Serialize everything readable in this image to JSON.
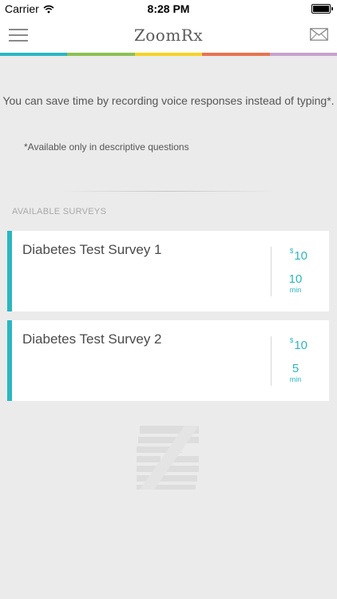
{
  "status_bar": {
    "carrier": "Carrier",
    "time": "8:28 PM"
  },
  "nav": {
    "title": "ZoomRx",
    "menu_icon": "hamburger-menu-icon",
    "mail_icon": "envelope-icon"
  },
  "brand_colors": [
    "#2bb6c0",
    "#8cc152",
    "#f5d327",
    "#e9734f",
    "#c7a2cc"
  ],
  "tip": {
    "text": "You can save time by recording voice responses instead of typing*.",
    "note": "*Available only in descriptive questions"
  },
  "section_header": "AVAILABLE SURVEYS",
  "surveys": [
    {
      "name": "Diabetes Test Survey 1",
      "currency": "$",
      "reward": "10",
      "duration": "10",
      "duration_unit": "min"
    },
    {
      "name": "Diabetes Test Survey 2",
      "currency": "$",
      "reward": "10",
      "duration": "5",
      "duration_unit": "min"
    }
  ],
  "accent_color": "#2bb6c0"
}
